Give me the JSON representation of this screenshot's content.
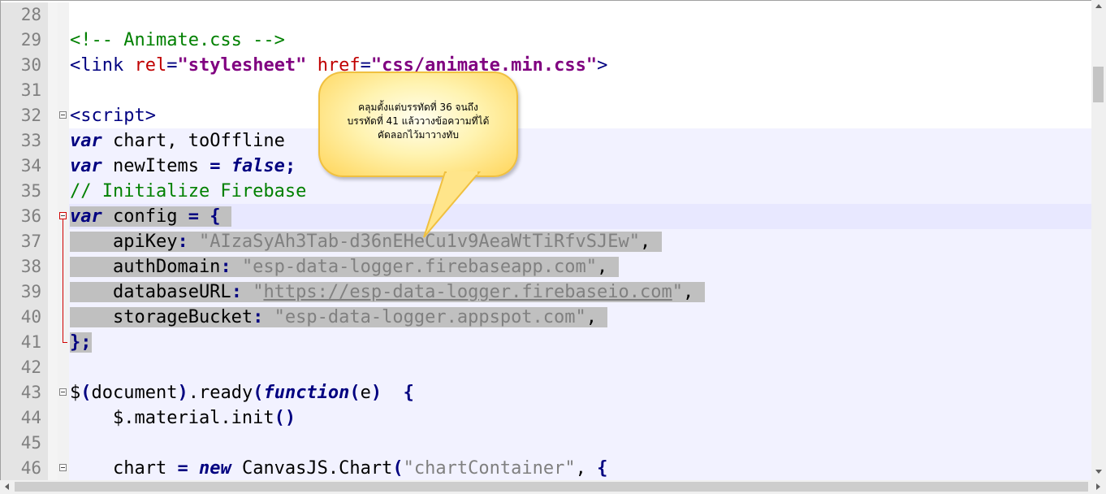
{
  "editor": {
    "lines": [
      {
        "n": "28",
        "fold": "none",
        "tokens": []
      },
      {
        "n": "29",
        "fold": "none",
        "tokens": [
          {
            "t": "<!-- Animate.css -->",
            "c": "cm"
          }
        ]
      },
      {
        "n": "30",
        "fold": "none",
        "tokens": [
          {
            "t": "<link ",
            "c": "tag"
          },
          {
            "t": "rel",
            "c": "attr"
          },
          {
            "t": "=",
            "c": "tag"
          },
          {
            "t": "\"stylesheet\"",
            "c": "atv"
          },
          {
            "t": " ",
            "c": ""
          },
          {
            "t": "href",
            "c": "attr"
          },
          {
            "t": "=",
            "c": "tag"
          },
          {
            "t": "\"css/animate.min.css\"",
            "c": "atv"
          },
          {
            "t": ">",
            "c": "tag"
          }
        ]
      },
      {
        "n": "31",
        "fold": "none",
        "tokens": []
      },
      {
        "n": "32",
        "fold": "box",
        "tokens": [
          {
            "t": "<script>",
            "c": "tag"
          }
        ]
      },
      {
        "n": "33",
        "fold": "none",
        "tokens": [
          {
            "t": "var",
            "c": "kw"
          },
          {
            "t": " chart, toOffline",
            "c": ""
          }
        ]
      },
      {
        "n": "34",
        "fold": "none",
        "tokens": [
          {
            "t": "var",
            "c": "kw"
          },
          {
            "t": " newItems ",
            "c": ""
          },
          {
            "t": "=",
            "c": "op"
          },
          {
            "t": " ",
            "c": ""
          },
          {
            "t": "false",
            "c": "kw"
          },
          {
            "t": ";",
            "c": "op"
          }
        ]
      },
      {
        "n": "35",
        "fold": "none",
        "tokens": [
          {
            "t": "// Initialize Firebase",
            "c": "cm"
          }
        ]
      },
      {
        "n": "36",
        "fold": "redbox",
        "current": true,
        "tokens": [
          {
            "t": "var",
            "c": "kw sel"
          },
          {
            "t": " config ",
            "c": "sel"
          },
          {
            "t": "=",
            "c": "op sel"
          },
          {
            "t": " ",
            "c": "sel"
          },
          {
            "t": "{",
            "c": "op sel"
          },
          {
            "t": " ",
            "c": "sel"
          }
        ]
      },
      {
        "n": "37",
        "fold": "line",
        "tokens": [
          {
            "t": "    apiKey",
            "c": "sel"
          },
          {
            "t": ":",
            "c": "op sel"
          },
          {
            "t": " ",
            "c": "sel"
          },
          {
            "t": "\"AIzaSyAh3Tab-d36nEHeCu1v9AeaWtTiRfvSJEw\"",
            "c": "str sel"
          },
          {
            "t": ", ",
            "c": "sel"
          }
        ]
      },
      {
        "n": "38",
        "fold": "line",
        "tokens": [
          {
            "t": "    authDomain",
            "c": "sel"
          },
          {
            "t": ":",
            "c": "op sel"
          },
          {
            "t": " ",
            "c": "sel"
          },
          {
            "t": "\"esp-data-logger.firebaseapp.com\"",
            "c": "str sel"
          },
          {
            "t": ", ",
            "c": "sel"
          }
        ]
      },
      {
        "n": "39",
        "fold": "line",
        "tokens": [
          {
            "t": "    databaseURL",
            "c": "sel"
          },
          {
            "t": ":",
            "c": "op sel"
          },
          {
            "t": " ",
            "c": "sel"
          },
          {
            "t": "\"",
            "c": "str sel"
          },
          {
            "t": "https://esp-data-logger.firebaseio.com",
            "c": "url sel"
          },
          {
            "t": "\"",
            "c": "str sel"
          },
          {
            "t": ", ",
            "c": "sel"
          }
        ]
      },
      {
        "n": "40",
        "fold": "line",
        "tokens": [
          {
            "t": "    storageBucket",
            "c": "sel"
          },
          {
            "t": ":",
            "c": "op sel"
          },
          {
            "t": " ",
            "c": "sel"
          },
          {
            "t": "\"esp-data-logger.appspot.com\"",
            "c": "str sel"
          },
          {
            "t": ", ",
            "c": "sel"
          }
        ]
      },
      {
        "n": "41",
        "fold": "end",
        "tokens": [
          {
            "t": "}",
            "c": "op sel"
          },
          {
            "t": ";",
            "c": "op sel"
          }
        ]
      },
      {
        "n": "42",
        "fold": "none",
        "tokens": []
      },
      {
        "n": "43",
        "fold": "box",
        "tokens": [
          {
            "t": "$",
            "c": ""
          },
          {
            "t": "(",
            "c": "op"
          },
          {
            "t": "document",
            "c": ""
          },
          {
            "t": ")",
            "c": "op"
          },
          {
            "t": ".ready",
            "c": ""
          },
          {
            "t": "(",
            "c": "op"
          },
          {
            "t": "function",
            "c": "kw"
          },
          {
            "t": "(",
            "c": "op"
          },
          {
            "t": "e",
            "c": ""
          },
          {
            "t": ")",
            "c": "op"
          },
          {
            "t": "  ",
            "c": ""
          },
          {
            "t": "{",
            "c": "op"
          }
        ]
      },
      {
        "n": "44",
        "fold": "none",
        "tokens": [
          {
            "t": "    $.material.init",
            "c": ""
          },
          {
            "t": "()",
            "c": "op"
          }
        ]
      },
      {
        "n": "45",
        "fold": "none",
        "tokens": []
      },
      {
        "n": "46",
        "fold": "box",
        "tokens": [
          {
            "t": "    chart ",
            "c": ""
          },
          {
            "t": "=",
            "c": "op"
          },
          {
            "t": " ",
            "c": ""
          },
          {
            "t": "new",
            "c": "kw"
          },
          {
            "t": " CanvasJS.Chart",
            "c": ""
          },
          {
            "t": "(",
            "c": "op"
          },
          {
            "t": "\"chartContainer\"",
            "c": "str"
          },
          {
            "t": ", ",
            "c": ""
          },
          {
            "t": "{",
            "c": "op"
          }
        ]
      }
    ]
  },
  "callout": {
    "line1": "คลุมตั้งแต่บรรทัดที่ 36 จนถึง",
    "line2": "บรรทัดที่ 41 แล้ววางข้อความที่ได้",
    "line3": "คัดลอกไว้มาวางทับ"
  },
  "colors": {
    "keyword": "#000080",
    "comment": "#008000",
    "attribute": "#c00000",
    "attrValue": "#800080",
    "string": "#808080",
    "selection": "#c0c0c0",
    "currentLine": "#e8e8ff"
  }
}
